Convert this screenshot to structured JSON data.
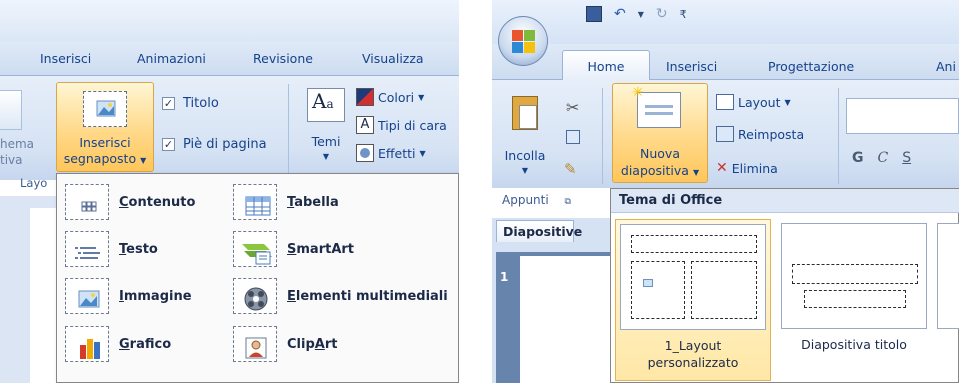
{
  "left": {
    "tabs": [
      "Inserisci",
      "Animazioni",
      "Revisione",
      "Visualizza"
    ],
    "ribbon": {
      "partial_left_top": "hema",
      "partial_left_bottom": "tiva",
      "insert_placeholder_line1": "Inserisci",
      "insert_placeholder_line2": "segnaposto",
      "title_check": "Titolo",
      "footer_check": "Piè di pagina",
      "themes_label": "Temi",
      "colors_label": "Colori",
      "fonts_label": "Tipi di cara",
      "effects_label": "Effetti",
      "group_label": "Layo",
      "partial_group_label": "Layo"
    },
    "dropdown_items": [
      {
        "text": "Contenuto",
        "key": "C",
        "rest": "ontenuto",
        "icon": "content-placeholder-icon"
      },
      {
        "text": "Tabella",
        "key": "T",
        "rest": "abella",
        "icon": "table-icon"
      },
      {
        "text": "Testo",
        "key": "T",
        "rest": "esto",
        "icon": "text-placeholder-icon"
      },
      {
        "text": "SmartArt",
        "key": "S",
        "rest": "martArt",
        "icon": "smartart-icon"
      },
      {
        "text": "Immagine",
        "key": "I",
        "rest": "mmagine",
        "icon": "picture-icon"
      },
      {
        "text": "Elementi multimediali",
        "key": "E",
        "rest": "lementi multimediali",
        "icon": "media-icon"
      },
      {
        "text": "Grafico",
        "key": "G",
        "rest": "rafico",
        "icon": "chart-icon"
      },
      {
        "text": "ClipArt",
        "pre": "Clip",
        "key": "A",
        "rest": "rt",
        "icon": "clipart-icon"
      }
    ]
  },
  "right": {
    "tabs": [
      "Home",
      "Inserisci",
      "Progettazione",
      "Ani"
    ],
    "ribbon": {
      "paste_label": "Incolla",
      "new_slide_line1": "Nuova",
      "new_slide_line2": "diapositiva",
      "layout_label": "Layout",
      "reset_label": "Reimposta",
      "delete_label": "Elimina",
      "clipboard_group": "Appunti",
      "bold": "G",
      "italic": "C",
      "underline": "S"
    },
    "gallery_header": "Tema di Office",
    "slides_tab": "Diapositive",
    "slide_number": "1",
    "layouts": [
      {
        "label_line1": "1_Layout",
        "label_line2": "personalizzato"
      },
      {
        "label_line1": "Diapositiva titolo",
        "label_line2": ""
      }
    ]
  }
}
